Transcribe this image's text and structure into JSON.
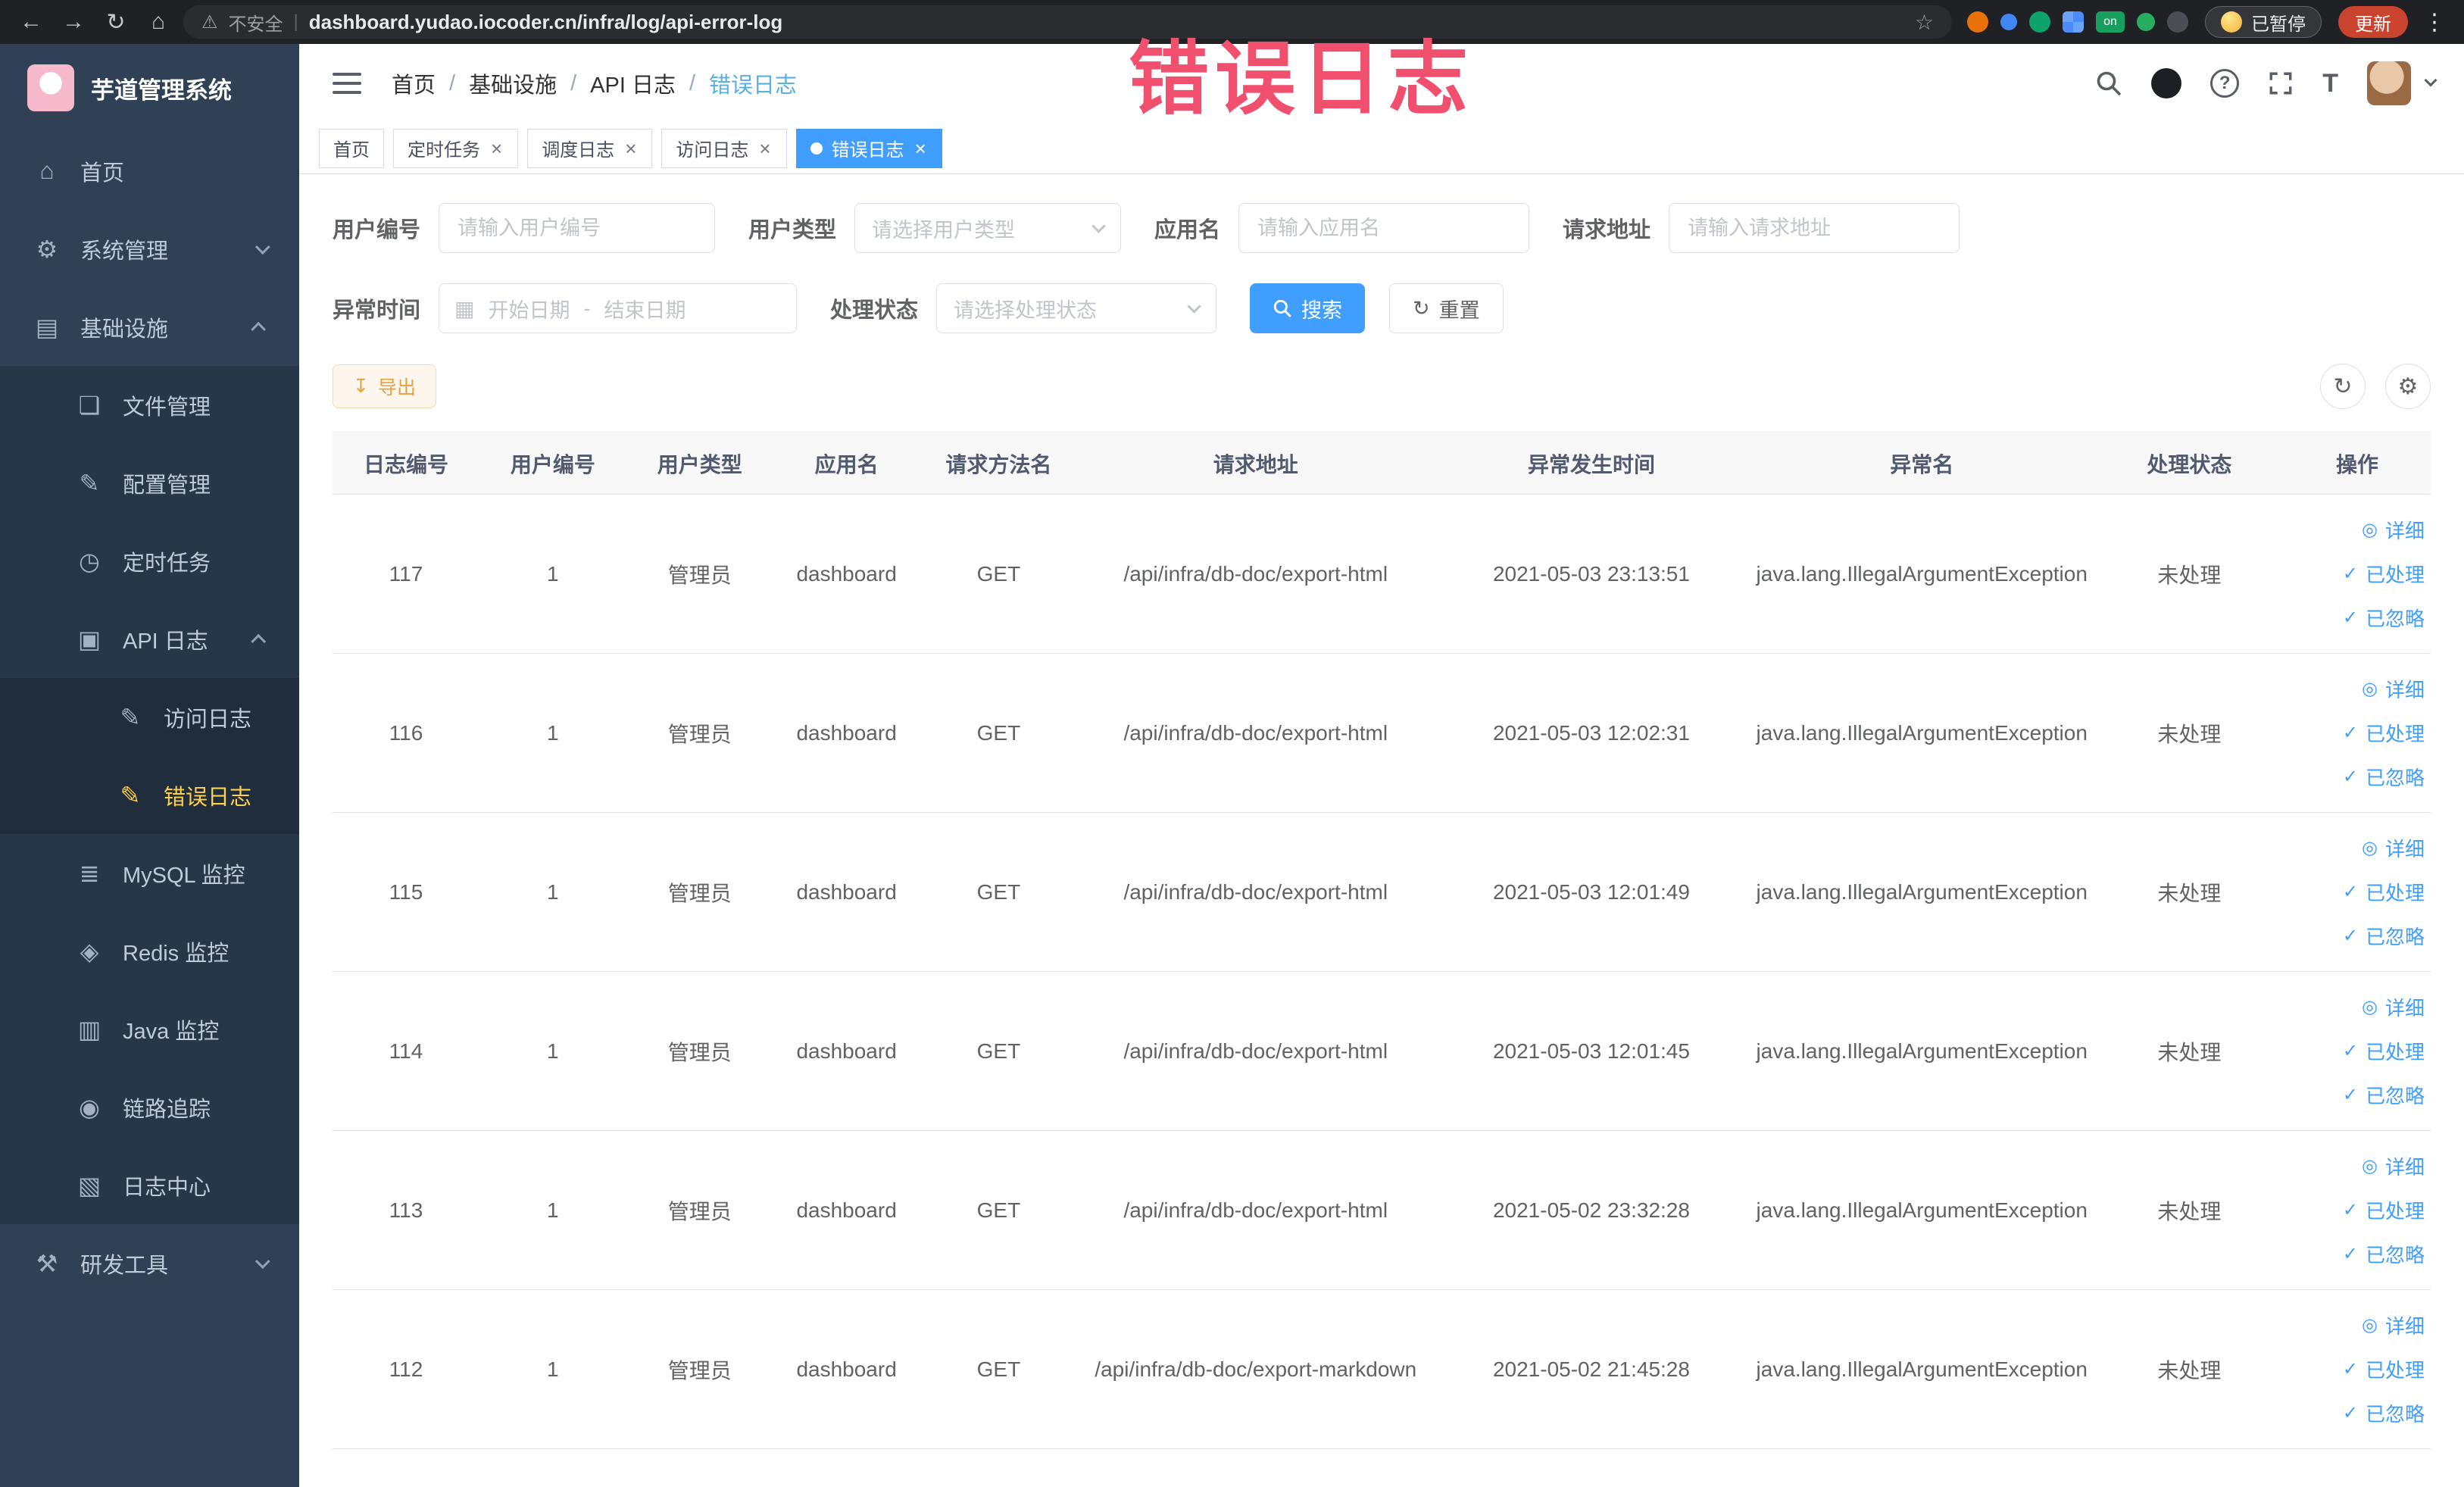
{
  "colors": {
    "accent_blue": "#409EFF",
    "sidebar_bg": "#304156",
    "sidebar_active_text": "#ffd04b",
    "warning_orange": "#e6a23c",
    "watermark_pink": "#f0506e"
  },
  "watermark": "错误日志",
  "browser": {
    "security_label": "不安全",
    "url": "dashboard.yudao.iocoder.cn/infra/log/api-error-log",
    "ext_on_label": "on",
    "paused_button": "已暂停",
    "update_button": "更新"
  },
  "icons": {
    "back": "←",
    "forward": "→",
    "reload": "↻",
    "home": "⌂",
    "warning": "⚠",
    "divider": "|",
    "star": "☆",
    "more": "⋮",
    "help": "?",
    "font_size": "T",
    "dashboard": "⌂",
    "gear": "⚙",
    "infra": "▤",
    "file": "❏",
    "config": "✎",
    "cron": "◷",
    "api": "▣",
    "doc": "✎",
    "mysql": "≣",
    "redis": "◈",
    "java": "▥",
    "trace": "◉",
    "logcenter": "▧",
    "tool": "⚒",
    "eye": "◎",
    "check": "✓",
    "close": "×",
    "refresh": "↻",
    "columns": "⚙",
    "calendar": "▦",
    "download": "↧"
  },
  "sidebar": {
    "logo_title": "芋道管理系统",
    "items": [
      {
        "label": "首页"
      },
      {
        "label": "系统管理"
      },
      {
        "label": "基础设施"
      },
      {
        "label": "文件管理"
      },
      {
        "label": "配置管理"
      },
      {
        "label": "定时任务"
      },
      {
        "label": "API 日志"
      },
      {
        "label": "访问日志"
      },
      {
        "label": "错误日志"
      },
      {
        "label": "MySQL 监控"
      },
      {
        "label": "Redis 监控"
      },
      {
        "label": "Java 监控"
      },
      {
        "label": "链路追踪"
      },
      {
        "label": "日志中心"
      },
      {
        "label": "研发工具"
      }
    ]
  },
  "navbar": {
    "breadcrumb": [
      "首页",
      "基础设施",
      "API 日志",
      "错误日志"
    ],
    "separator": "/"
  },
  "tabs": [
    {
      "label": "首页"
    },
    {
      "label": "定时任务"
    },
    {
      "label": "调度日志"
    },
    {
      "label": "访问日志"
    },
    {
      "label": "错误日志"
    }
  ],
  "filters": {
    "user_id_label": "用户编号",
    "user_id_placeholder": "请输入用户编号",
    "user_type_label": "用户类型",
    "user_type_placeholder": "请选择用户类型",
    "app_name_label": "应用名",
    "app_name_placeholder": "请输入应用名",
    "request_url_label": "请求地址",
    "request_url_placeholder": "请输入请求地址",
    "exception_time_label": "异常时间",
    "date_start_placeholder": "开始日期",
    "date_separator": "-",
    "date_end_placeholder": "结束日期",
    "process_status_label": "处理状态",
    "process_status_placeholder": "请选择处理状态",
    "search_label": "搜索",
    "reset_label": "重置"
  },
  "toolbar": {
    "export_label": "导出"
  },
  "table": {
    "headers": [
      "日志编号",
      "用户编号",
      "用户类型",
      "应用名",
      "请求方法名",
      "请求地址",
      "异常发生时间",
      "异常名",
      "处理状态",
      "操作"
    ],
    "actions": [
      "详细",
      "已处理",
      "已忽略"
    ],
    "rows": [
      {
        "id": "117",
        "user_id": "1",
        "user_type": "管理员",
        "app": "dashboard",
        "method": "GET",
        "url": "/api/infra/db-doc/export-html",
        "time": "2021-05-03 23:13:51",
        "exception": "java.lang.IllegalArgumentException",
        "status": "未处理"
      },
      {
        "id": "116",
        "user_id": "1",
        "user_type": "管理员",
        "app": "dashboard",
        "method": "GET",
        "url": "/api/infra/db-doc/export-html",
        "time": "2021-05-03 12:02:31",
        "exception": "java.lang.IllegalArgumentException",
        "status": "未处理"
      },
      {
        "id": "115",
        "user_id": "1",
        "user_type": "管理员",
        "app": "dashboard",
        "method": "GET",
        "url": "/api/infra/db-doc/export-html",
        "time": "2021-05-03 12:01:49",
        "exception": "java.lang.IllegalArgumentException",
        "status": "未处理"
      },
      {
        "id": "114",
        "user_id": "1",
        "user_type": "管理员",
        "app": "dashboard",
        "method": "GET",
        "url": "/api/infra/db-doc/export-html",
        "time": "2021-05-03 12:01:45",
        "exception": "java.lang.IllegalArgumentException",
        "status": "未处理"
      },
      {
        "id": "113",
        "user_id": "1",
        "user_type": "管理员",
        "app": "dashboard",
        "method": "GET",
        "url": "/api/infra/db-doc/export-html",
        "time": "2021-05-02 23:32:28",
        "exception": "java.lang.IllegalArgumentException",
        "status": "未处理"
      },
      {
        "id": "112",
        "user_id": "1",
        "user_type": "管理员",
        "app": "dashboard",
        "method": "GET",
        "url": "/api/infra/db-doc/export-markdown",
        "time": "2021-05-02 21:45:28",
        "exception": "java.lang.IllegalArgumentException",
        "status": "未处理"
      }
    ]
  }
}
